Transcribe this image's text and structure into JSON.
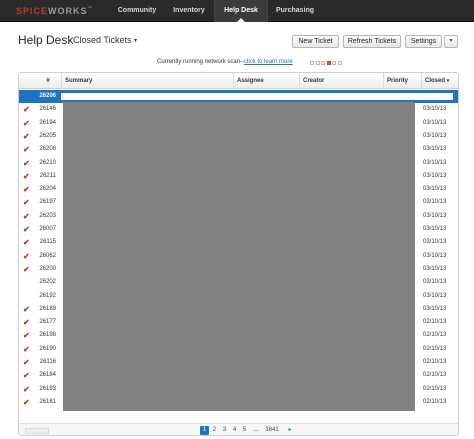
{
  "nav": {
    "logo_main": "SPICE",
    "logo_accent": "WORKS",
    "logo_tm": "™",
    "items": [
      {
        "label": "Community"
      },
      {
        "label": "Inventory"
      },
      {
        "label": "Help Desk",
        "active": true
      },
      {
        "label": "Purchasing"
      }
    ]
  },
  "header": {
    "title": "Help Desk",
    "view_label": "Closed Tickets",
    "view_caret": "▾",
    "buttons": {
      "new_ticket": "New Ticket",
      "refresh": "Refresh Tickets",
      "settings": "Settings",
      "settings_caret": "▾"
    }
  },
  "scan": {
    "text": "Currently running network scan--",
    "link": "click to learn more",
    "progress_active_index": 3,
    "progress_steps": 6
  },
  "table": {
    "columns": {
      "number": "#",
      "summary": "Summary",
      "assignee": "Assignee",
      "creator": "Creator",
      "priority": "Priority",
      "closed": "Closed"
    },
    "sort_indicator": "▾",
    "check_glyph": "✔",
    "rows": [
      {
        "id": "26206",
        "checked": false,
        "closed": "",
        "selected": true
      },
      {
        "id": "26146",
        "checked": true,
        "closed": "03/10/13"
      },
      {
        "id": "26194",
        "checked": true,
        "closed": "03/10/13"
      },
      {
        "id": "26205",
        "checked": true,
        "closed": "03/10/13"
      },
      {
        "id": "26208",
        "checked": true,
        "closed": "03/10/13"
      },
      {
        "id": "26210",
        "checked": true,
        "closed": "03/10/13"
      },
      {
        "id": "26211",
        "checked": true,
        "closed": "03/10/13"
      },
      {
        "id": "26204",
        "checked": true,
        "closed": "03/10/13"
      },
      {
        "id": "26197",
        "checked": true,
        "closed": "03/10/13"
      },
      {
        "id": "26203",
        "checked": true,
        "closed": "03/10/13"
      },
      {
        "id": "26007",
        "checked": true,
        "closed": "03/10/13"
      },
      {
        "id": "26115",
        "checked": true,
        "closed": "03/10/13"
      },
      {
        "id": "26062",
        "checked": true,
        "closed": "03/10/13"
      },
      {
        "id": "26200",
        "checked": true,
        "closed": "03/10/13"
      },
      {
        "id": "26202",
        "checked": false,
        "closed": "03/10/13"
      },
      {
        "id": "26192",
        "checked": false,
        "closed": "03/10/13"
      },
      {
        "id": "26189",
        "checked": true,
        "closed": "03/10/13"
      },
      {
        "id": "26177",
        "checked": true,
        "closed": "02/10/13"
      },
      {
        "id": "26198",
        "checked": true,
        "closed": "02/10/13"
      },
      {
        "id": "26190",
        "checked": true,
        "closed": "02/10/13"
      },
      {
        "id": "26116",
        "checked": true,
        "closed": "02/10/13"
      },
      {
        "id": "26184",
        "checked": true,
        "closed": "02/10/13"
      },
      {
        "id": "26193",
        "checked": true,
        "closed": "02/10/13"
      },
      {
        "id": "26181",
        "checked": true,
        "closed": "02/10/13"
      }
    ]
  },
  "pagination": {
    "pages": [
      "1",
      "2",
      "3",
      "4",
      "5",
      "...",
      "1841"
    ],
    "current": "1",
    "next": "▸"
  },
  "colors": {
    "accent_blue": "#1c74c4",
    "check_red": "#c0392b",
    "nav_bg": "#2a2a2a",
    "scan_active": "#e05a1c"
  }
}
